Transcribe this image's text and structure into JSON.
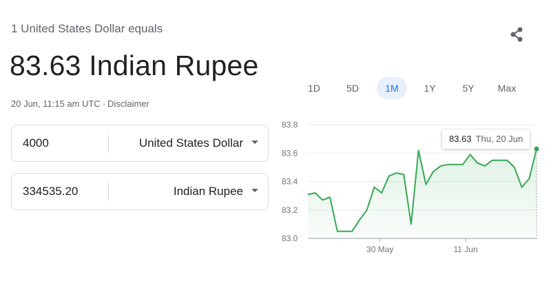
{
  "header": {
    "equals_text": "1 United States Dollar equals",
    "converted_value": "83.63 Indian Rupee",
    "timestamp": "20 Jun, 11:15 am UTC",
    "separator": "·",
    "disclaimer": "Disclaimer",
    "share_icon": "share-icon"
  },
  "converter": {
    "from": {
      "amount": "4000",
      "currency": "United States Dollar"
    },
    "to": {
      "amount": "334535.20",
      "currency": "Indian Rupee"
    }
  },
  "ranges": {
    "items": [
      "1D",
      "5D",
      "1M",
      "1Y",
      "5Y",
      "Max"
    ],
    "selected": "1M"
  },
  "tooltip": {
    "value": "83.63",
    "date": "Thu, 20 Jun"
  },
  "colors": {
    "line": "#34a853",
    "active_range_bg": "#e8f0fe",
    "active_range_text": "#1a73e8"
  },
  "chart_data": {
    "type": "line",
    "x_tick_labels": [
      "30 May",
      "11 Jun"
    ],
    "y_tick_labels": [
      "83.8",
      "83.6",
      "83.4",
      "83.2",
      "83.0"
    ],
    "ylim": [
      83.0,
      83.8
    ],
    "grid": true,
    "series": [
      {
        "values": [
          83.31,
          83.32,
          83.27,
          83.29,
          83.05,
          83.05,
          83.05,
          83.13,
          83.2,
          83.36,
          83.32,
          83.44,
          83.46,
          83.45,
          83.1,
          83.62,
          83.38,
          83.47,
          83.51,
          83.52,
          83.52,
          83.52,
          83.59,
          83.53,
          83.51,
          83.55,
          83.55,
          83.55,
          83.5,
          83.36,
          83.42,
          83.63
        ]
      }
    ]
  }
}
